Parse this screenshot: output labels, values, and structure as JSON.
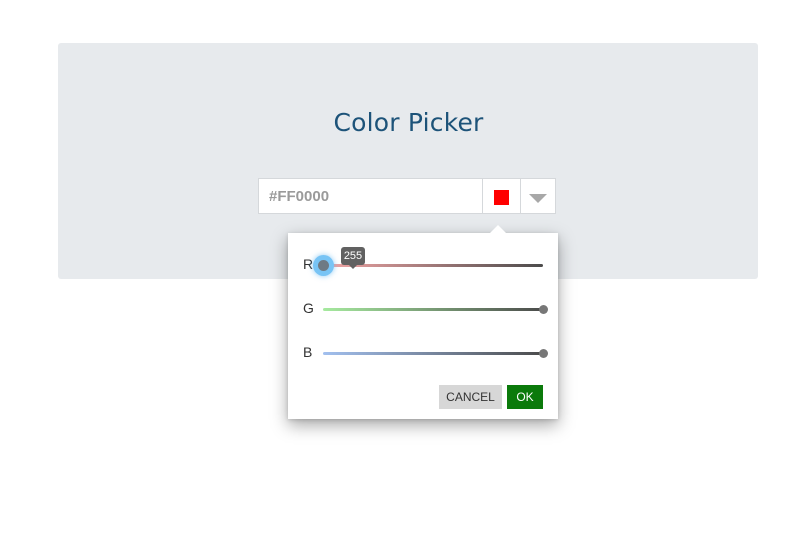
{
  "title": "Color Picker",
  "color_input": {
    "value": "#FF0000",
    "swatch_color": "#ff0000"
  },
  "popup": {
    "sliders": [
      {
        "label": "R",
        "value": 255,
        "max": 255,
        "fraction": 0.0,
        "tooltip": "255",
        "gradient": [
          "#f4a6a6",
          "#4b4b4b"
        ]
      },
      {
        "label": "G",
        "value": 0,
        "max": 255,
        "fraction": 1.0,
        "gradient": [
          "#a6ea9f",
          "#4b4b4b"
        ]
      },
      {
        "label": "B",
        "value": 0,
        "max": 255,
        "fraction": 1.0,
        "gradient": [
          "#a2c0ef",
          "#4b4b4b"
        ]
      }
    ],
    "cancel_label": "CANCEL",
    "ok_label": "OK"
  },
  "colors": {
    "title": "#1d5379",
    "ok_button": "#0b7a0b",
    "panel_bg": "#e7eaed"
  },
  "icons": {
    "dropdown": "chevron-down-icon"
  }
}
